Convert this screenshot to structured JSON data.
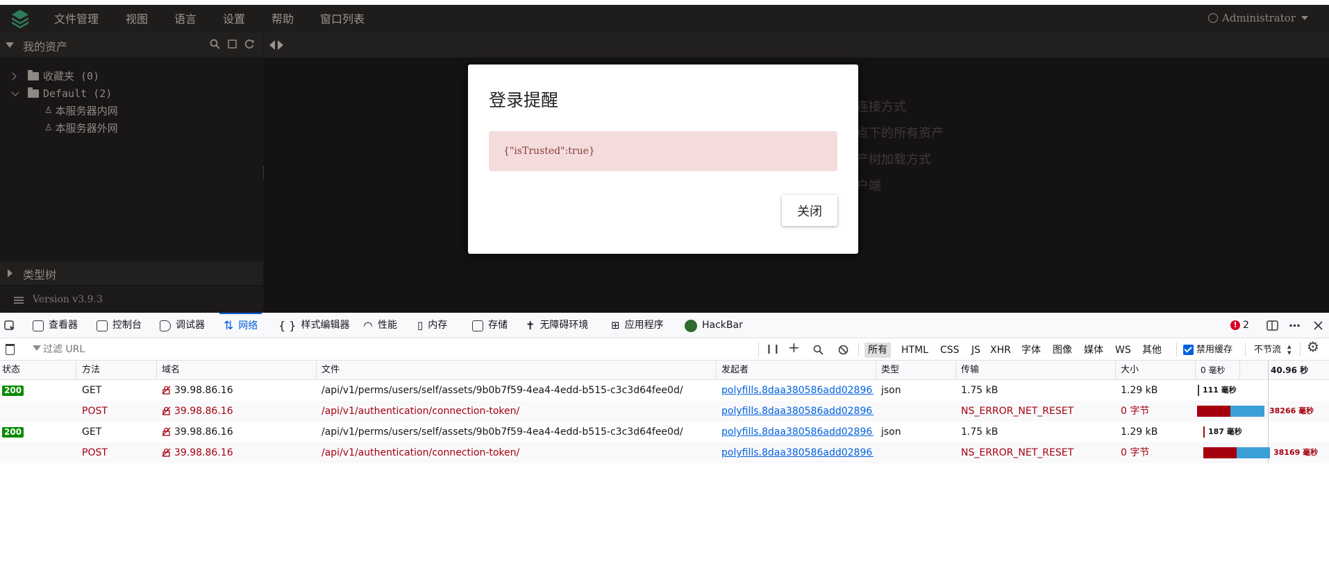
{
  "menubar": {
    "items": [
      "文件管理",
      "视图",
      "语言",
      "设置",
      "帮助",
      "窗口列表"
    ],
    "user": "Administrator"
  },
  "sidebar": {
    "header": "我的资产",
    "tree": {
      "favorites": "收藏夹 (0)",
      "default": "Default (2)",
      "leaves": [
        "本服务器内网",
        "本服务器外网"
      ]
    },
    "type_tree": "类型树",
    "version": "Version v3.9.3"
  },
  "main": {
    "bg_lines": [
      "连接方式",
      "点下的所有资产",
      "产树加载方式",
      "户端"
    ]
  },
  "modal": {
    "title": "登录提醒",
    "message": "{\"isTrusted\":true}",
    "close_label": "关闭"
  },
  "devtools": {
    "tabs": [
      "查看器",
      "控制台",
      "调试器",
      "网络",
      "样式编辑器",
      "性能",
      "内存",
      "存储",
      "无障碍环境",
      "应用程序",
      "HackBar"
    ],
    "active_tab": "网络",
    "error_count": "2",
    "filter_placeholder": "过滤 URL",
    "type_filters": [
      "所有",
      "HTML",
      "CSS",
      "JS",
      "XHR",
      "字体",
      "图像",
      "媒体",
      "WS",
      "其他"
    ],
    "disable_cache": "禁用缓存",
    "throttle": "不节流",
    "columns": [
      "状态",
      "方法",
      "域名",
      "文件",
      "发起者",
      "类型",
      "传输",
      "大小"
    ],
    "waterfall_header": [
      "0 毫秒",
      "40.96 秒"
    ],
    "rows": [
      {
        "status": "200",
        "method": "GET",
        "domain": "39.98.86.16",
        "file": "/api/v1/perms/users/self/assets/9b0b7f59-4ea4-4edd-b515-c3c3d64fee0d/",
        "initiator": "polyfills.8daa380586add02896...",
        "type": "json",
        "transfer": "1.75 kB",
        "size": "1.29 kB",
        "timing": "111 毫秒",
        "error": false
      },
      {
        "status": "",
        "method": "POST",
        "domain": "39.98.86.16",
        "file": "/api/v1/authentication/connection-token/",
        "initiator": "polyfills.8daa380586add02896...",
        "type": "",
        "transfer": "NS_ERROR_NET_RESET",
        "size": "0 字节",
        "timing": "38266 毫秒",
        "error": true
      },
      {
        "status": "200",
        "method": "GET",
        "domain": "39.98.86.16",
        "file": "/api/v1/perms/users/self/assets/9b0b7f59-4ea4-4edd-b515-c3c3d64fee0d/",
        "initiator": "polyfills.8daa380586add02896...",
        "type": "json",
        "transfer": "1.75 kB",
        "size": "1.29 kB",
        "timing": "187 毫秒",
        "error": false
      },
      {
        "status": "",
        "method": "POST",
        "domain": "39.98.86.16",
        "file": "/api/v1/authentication/connection-token/",
        "initiator": "polyfills.8daa380586add02896...",
        "type": "",
        "transfer": "NS_ERROR_NET_RESET",
        "size": "0 字节",
        "timing": "38169 毫秒",
        "error": true
      }
    ],
    "colors": {
      "accent": "#0060df",
      "error": "#a4000f",
      "ok": "#058b00",
      "wait": "#a4000f",
      "receive": "#3ba0d8"
    }
  }
}
